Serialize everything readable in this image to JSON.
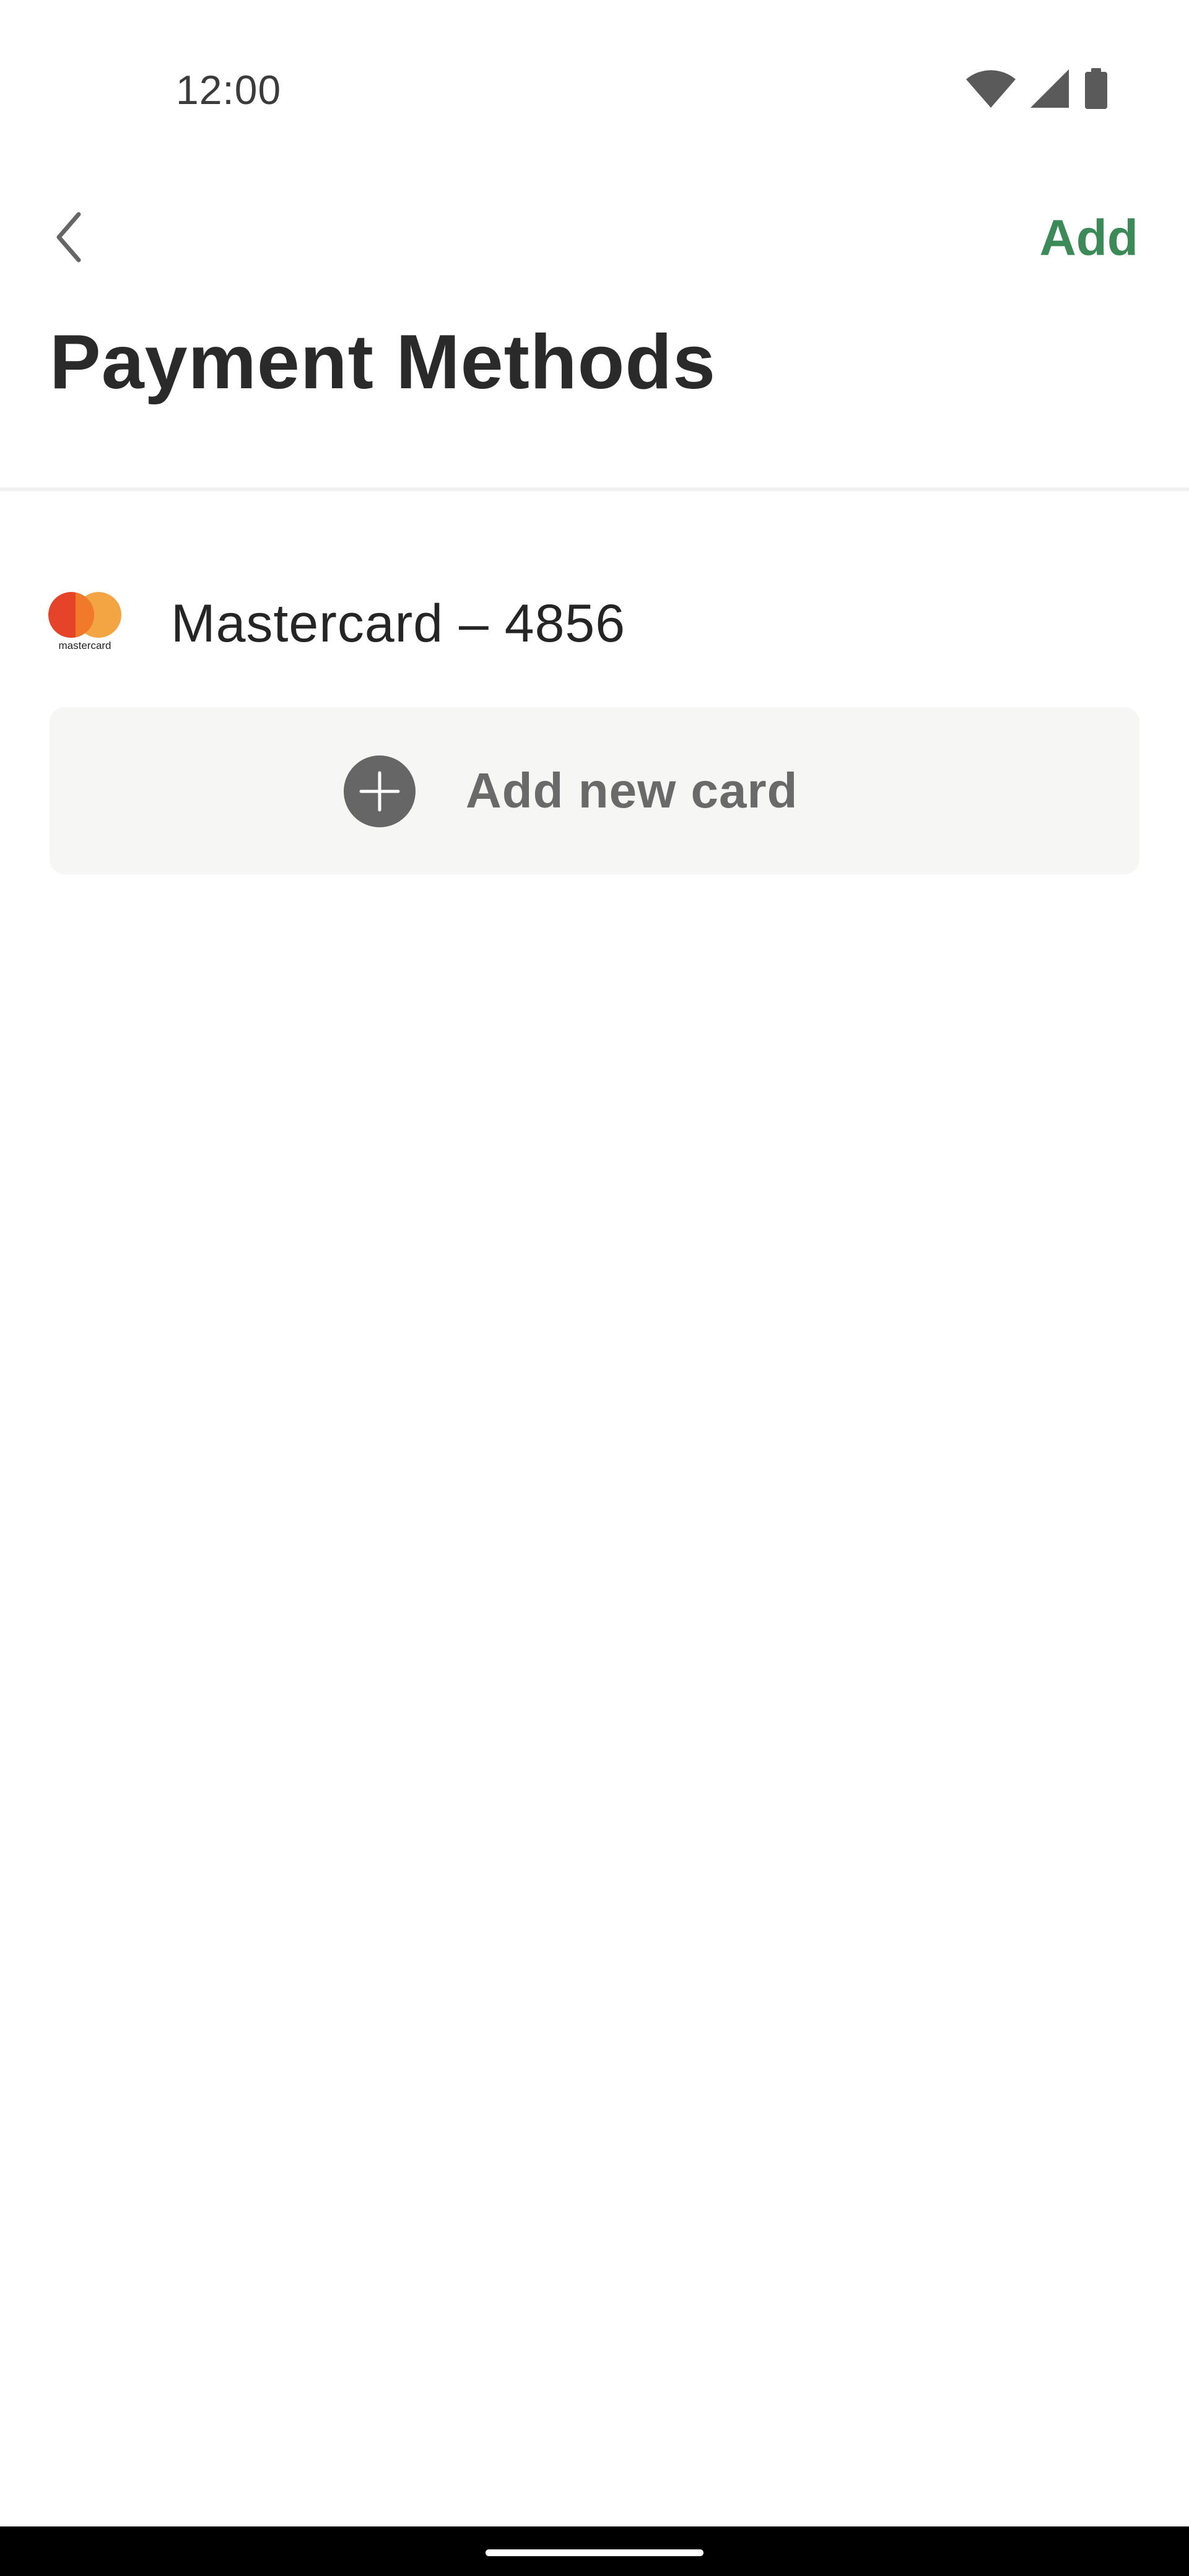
{
  "status_bar": {
    "time": "12:00",
    "icons": [
      "wifi-icon",
      "cellular-signal-icon",
      "battery-icon"
    ]
  },
  "toolbar": {
    "back_icon": "chevron-left-icon",
    "add_label": "Add"
  },
  "page": {
    "title": "Payment Methods"
  },
  "payment_methods": [
    {
      "brand": "mastercard",
      "brand_logo_text": "mastercard",
      "label": "Mastercard – 4856"
    }
  ],
  "add_card": {
    "icon": "plus-circle-icon",
    "label": "Add new card"
  },
  "colors": {
    "accent_green": "#3c8a57",
    "mastercard_red": "#e64429",
    "mastercard_orange": "#f2a542",
    "button_background": "#f6f6f4",
    "icon_grey": "#666666"
  }
}
